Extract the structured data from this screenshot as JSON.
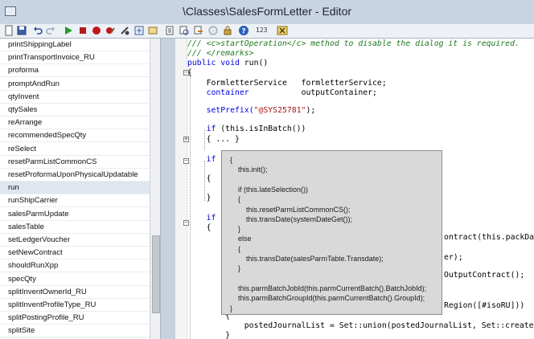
{
  "window": {
    "title": "\\Classes\\SalesFormLetter - Editor"
  },
  "toolbar": {
    "icons": [
      "new-file-icon",
      "save-icon",
      "undo-icon",
      "redo-icon",
      "run-icon",
      "stop-icon",
      "breakpoint-icon",
      "remove-breakpoints-icon",
      "compile-icon",
      "lookup-properties-icon",
      "lookup-methods-icon",
      "script-icon",
      "find-icon",
      "replace-icon",
      "scan-icon",
      "lock-icon",
      "help-icon",
      "line-numbers-icon",
      "x-icon"
    ],
    "line_numbers_label": "123"
  },
  "method_list": {
    "items": [
      "printShippingLabel",
      "printTransportInvoice_RU",
      "proforma",
      "promptAndRun",
      "qtyInvent",
      "qtySales",
      "reArrange",
      "recommendedSpecQty",
      "reSelect",
      "resetParmListCommonCS",
      "resetProformaUponPhysicalUpdatable",
      "run",
      "runShipCarrier",
      "salesParmUpdate",
      "salesTable",
      "setLedgerVoucher",
      "setNewContract",
      "shouldRunXpp",
      "specQty",
      "splitInventOwnerId_RU",
      "splitInventProfileType_RU",
      "splitPostingProfile_RU",
      "splitSite"
    ],
    "selected": "run"
  },
  "code": {
    "l01": "/// <c>startOperation</c> method to disable the dialog it is required.",
    "l02": "/// </remarks>",
    "l03a": "public void",
    "l03b": " run()",
    "l04": "{",
    "l05a": "    FormletterService   formletterService;",
    "l06a": "    container",
    "l06b": "           outputContainer;",
    "l07a": "    setPrefix(",
    "l07b": "\"@SYS25781\"",
    "l07c": ");",
    "l08a": "    if",
    "l08b": " (this.isInBatch())",
    "l09": "    { ... }",
    "l10": "    if",
    "l11": "    {",
    "l12": "    }",
    "l13": "    if",
    "l14": "    {",
    "l15": "ontract(this.packDa",
    "l16": "er);",
    "l17": "OutputContract();",
    "l18": "Region([#isoRU]))",
    "l19": "        {",
    "l20": "            postedJournalList = Set::union(postedJournalList, Set::create(",
    "l21": "        }"
  },
  "tooltip": {
    "lines": [
      "{",
      "    this.init();",
      "",
      "    if (this.lateSelection())",
      "    {",
      "        this.resetParmListCommonCS();",
      "        this.transDate(systemDateGet());",
      "    }",
      "    else",
      "    {",
      "        this.transDate(salesParmTable.Transdate);",
      "    }",
      "",
      "    this.parmBatchJobId(this.parmCurrentBatch().BatchJobId);",
      "    this.parmBatchGroupId(this.parmCurrentBatch().GroupId);",
      "}"
    ]
  },
  "colors": {
    "comment": "#1f7a1f",
    "keyword": "#0000e0",
    "string": "#a31515",
    "tooltip_bg": "#d9d9d9"
  }
}
